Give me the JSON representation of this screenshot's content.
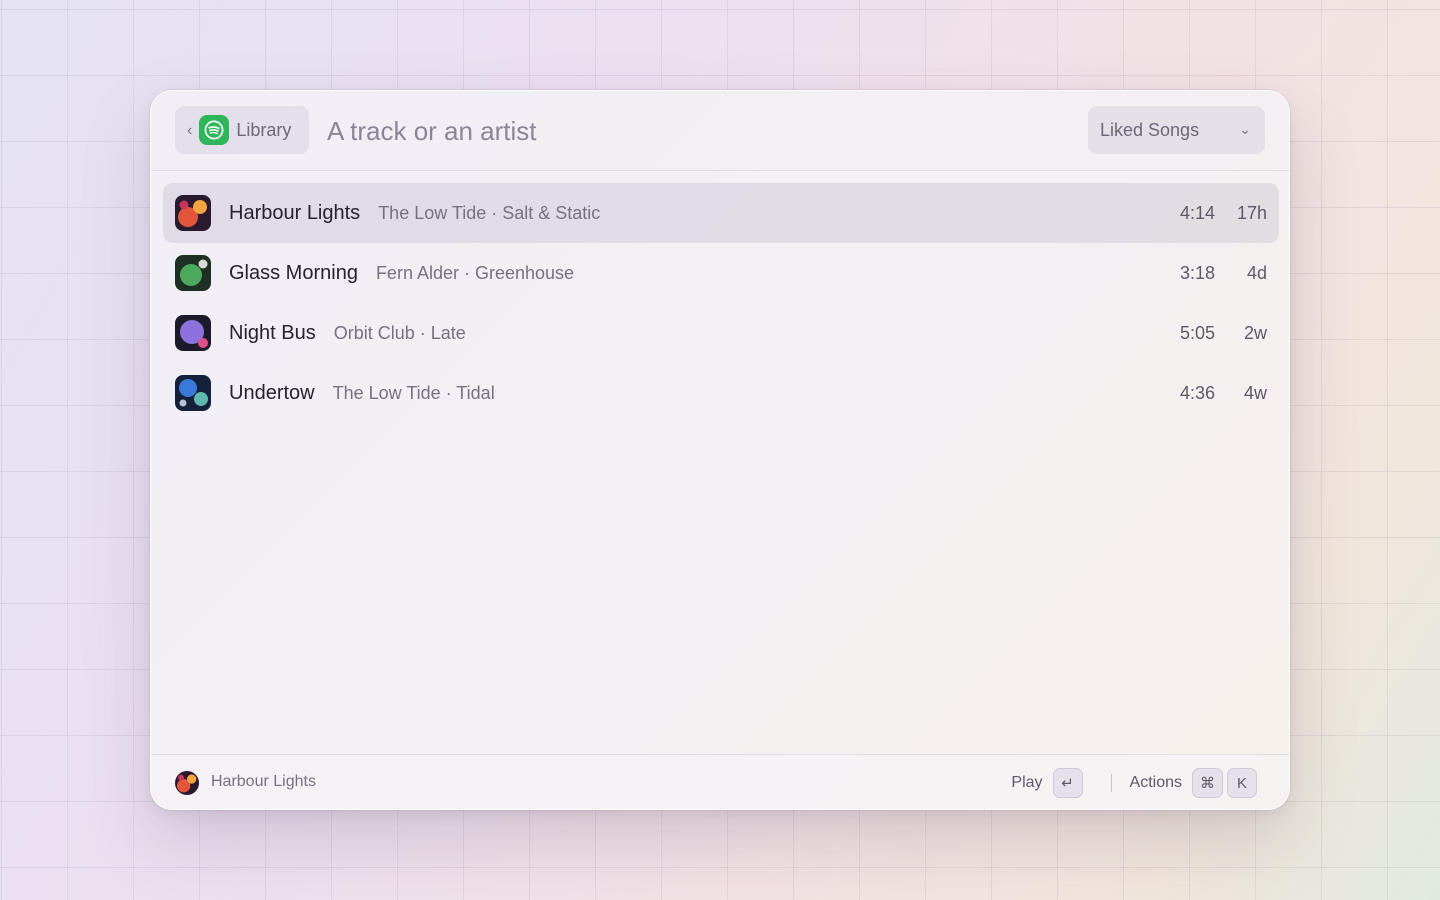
{
  "header": {
    "back_label": "Library",
    "search_placeholder": "A track or an artist",
    "search_value": "",
    "dropdown": {
      "selected": "Liked Songs"
    }
  },
  "tracks": [
    {
      "title": "Harbour Lights",
      "subtitle": "The Low Tide · Salt & Static",
      "duration": "4:14",
      "added": "17h",
      "selected": true
    },
    {
      "title": "Glass Morning",
      "subtitle": "Fern Alder · Greenhouse",
      "duration": "3:18",
      "added": "4d",
      "selected": false
    },
    {
      "title": "Night Bus",
      "subtitle": "Orbit Club · Late",
      "duration": "5:05",
      "added": "2w",
      "selected": false
    },
    {
      "title": "Undertow",
      "subtitle": "The Low Tide · Tidal",
      "duration": "4:36",
      "added": "4w",
      "selected": false
    }
  ],
  "footer": {
    "selected_title": "Harbour Lights",
    "primary_action": "Play",
    "primary_key": "↵",
    "secondary_action": "Actions",
    "secondary_keys": [
      "⌘",
      "K"
    ]
  },
  "icons": {
    "back": "chevron-left-icon",
    "app": "spotify-icon",
    "dropdown": "chevron-down-icon"
  },
  "colors": {
    "spotify_green": "#2fb55a",
    "selection_bg": "#e3dde6"
  }
}
